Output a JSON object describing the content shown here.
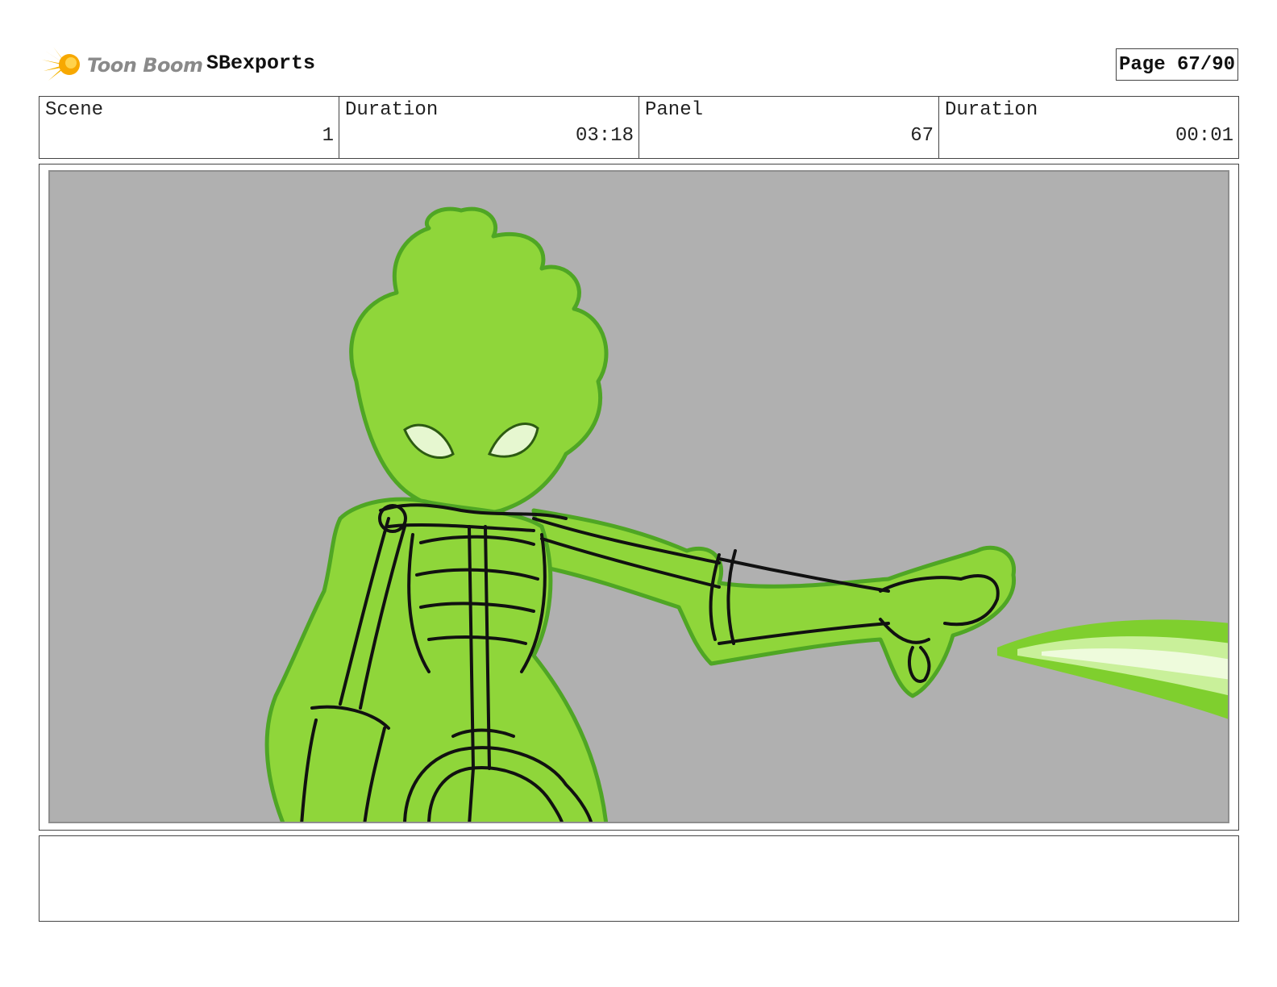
{
  "header": {
    "logo_text": "Toon Boom",
    "project_title": "SBexports",
    "page_label": "Page 67/90"
  },
  "info": [
    {
      "label": "Scene",
      "value": "1"
    },
    {
      "label": "Duration",
      "value": "03:18"
    },
    {
      "label": "Panel",
      "value": "67"
    },
    {
      "label": "Duration",
      "value": "00:01"
    }
  ],
  "panel": {
    "background_color": "#b0b0b0",
    "glow_color": "#8fd63a",
    "outline_color": "#111111"
  },
  "notes": {
    "text": ""
  }
}
